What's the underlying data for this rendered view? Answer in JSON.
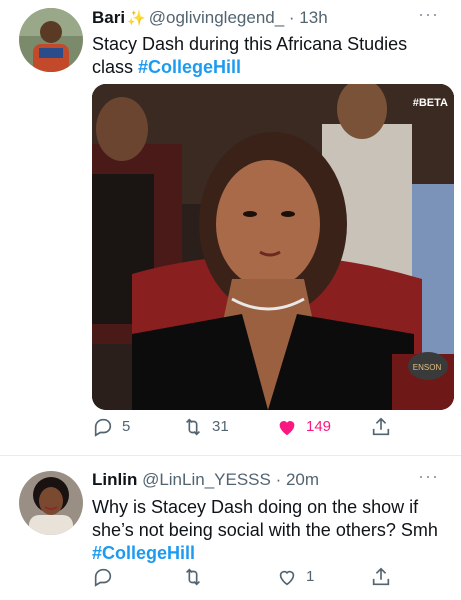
{
  "tweets": [
    {
      "author_name": "Bari",
      "author_emoji": "✨",
      "handle": "@oglivinglegend_",
      "time": "· 13h",
      "text": "Stacy Dash during this Africana Studies class ",
      "hashtag": "#CollegeHill",
      "media": {
        "watermark": "#BETA"
      },
      "actions": {
        "replies": "5",
        "retweets": "31",
        "likes": "149"
      }
    },
    {
      "author_name": "Linlin",
      "handle": "@LinLin_YESSS",
      "time": "· 20m",
      "text": "Why is Stacey Dash doing on the show if she’s not being social with the others? Smh ",
      "hashtag": "#CollegeHill",
      "actions": {
        "replies": "",
        "retweets": "",
        "likes": "1"
      }
    }
  ],
  "more_icon": "···",
  "colors": {
    "link": "#1d9bf0",
    "like": "#f91880",
    "meta": "#536471"
  }
}
